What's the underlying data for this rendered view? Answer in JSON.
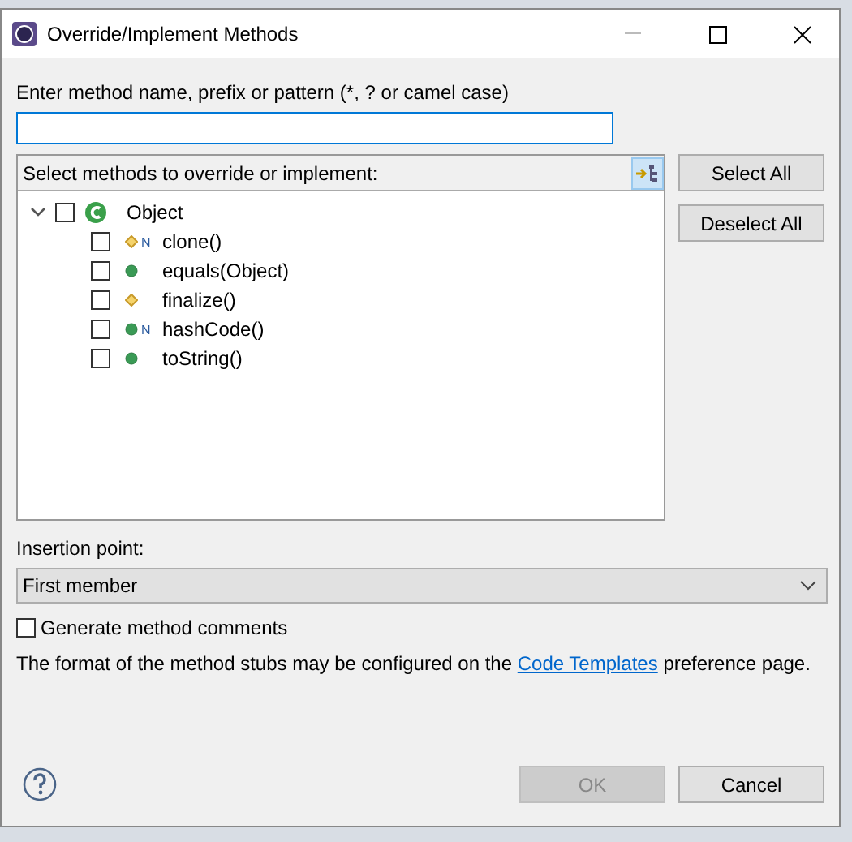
{
  "window": {
    "title": "Override/Implement Methods"
  },
  "filter": {
    "label": "Enter method name, prefix or pattern (*, ? or camel case)"
  },
  "methods_panel": {
    "title": "Select methods to override or implement:",
    "tree": {
      "name": "Object",
      "expanded": true,
      "checked": false,
      "children": [
        {
          "name": "clone()",
          "kind": "protected",
          "native_mark": "N",
          "checked": false
        },
        {
          "name": "equals(Object)",
          "kind": "public",
          "checked": false
        },
        {
          "name": "finalize()",
          "kind": "protected",
          "checked": false
        },
        {
          "name": "hashCode()",
          "kind": "public",
          "native_mark": "N",
          "checked": false
        },
        {
          "name": "toString()",
          "kind": "public",
          "checked": false
        }
      ]
    }
  },
  "side_buttons": [
    {
      "label": "Select All"
    },
    {
      "label": "Deselect All"
    }
  ],
  "insertion_point": {
    "label": "Insertion point:",
    "value": "First member"
  },
  "generate_comments": {
    "label": "Generate method comments",
    "checked": false
  },
  "info": {
    "before": "The format of the method stubs may be configured on the",
    "link": "Code Templates",
    "after": "preference page."
  },
  "buttons": [
    {
      "label": "OK",
      "disabled": true
    },
    {
      "label": "Cancel",
      "disabled": false
    }
  ]
}
